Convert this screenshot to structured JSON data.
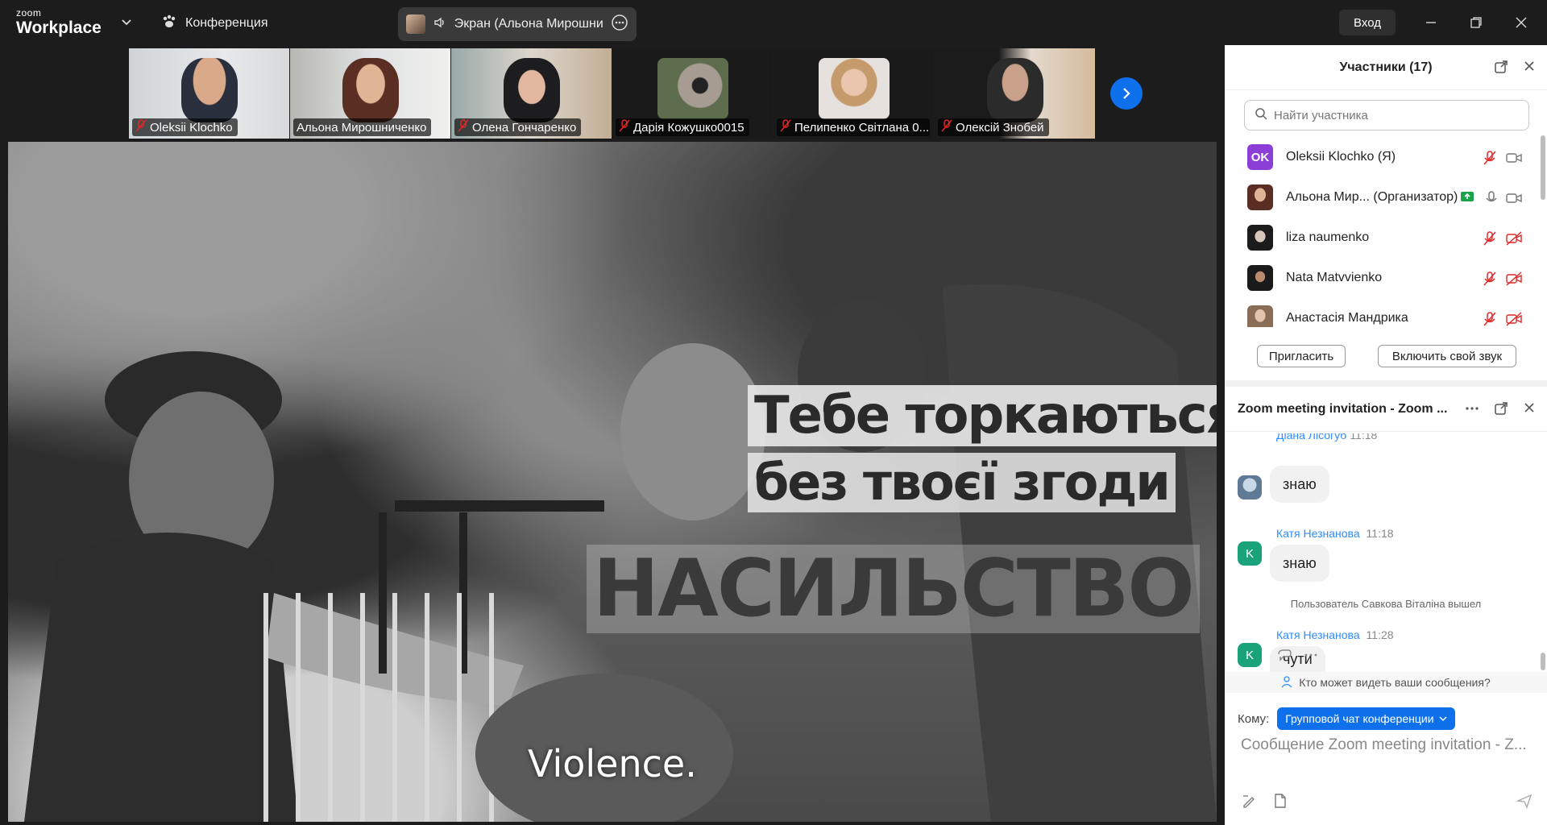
{
  "app": {
    "logo_line1": "zoom",
    "logo_line2": "Workplace",
    "conference_label": "Конференция",
    "share_label": "Экран (Альона Мирошнич",
    "login_label": "Вход"
  },
  "thumbnails": [
    {
      "name": "Oleksii Klochko",
      "muted": true
    },
    {
      "name": "Альона Мирошниченко",
      "muted": false
    },
    {
      "name": "Олена Гончаренко",
      "muted": true
    },
    {
      "name": "Дарія Кожушко0015",
      "muted": true,
      "active": true
    },
    {
      "name": "Пелипенко Світлана 0...",
      "muted": true
    },
    {
      "name": "Олексій Знобей",
      "muted": true
    }
  ],
  "stage": {
    "caption_line1": "Тебе торкаються",
    "caption_line2": "без твоєї згоди",
    "caption_line3": "НАСИЛЬСТВО",
    "subtitle": "Violence."
  },
  "participants": {
    "title": "Участники (17)",
    "search_placeholder": "Найти участника",
    "list": [
      {
        "initials": "OK",
        "name": "Oleksii Klochko (Я)"
      },
      {
        "name": "Альона Мир...  (Организатор)"
      },
      {
        "name": "liza naumenko"
      },
      {
        "name": "Nata Matvvienko"
      },
      {
        "name": "Анастасія Мандрика"
      }
    ],
    "invite_label": "Пригласить",
    "unmute_label": "Включить свой звук"
  },
  "chat": {
    "title": "Zoom meeting invitation - Zoom ...",
    "partial_sender": "Діана Лісогуб",
    "partial_time": "11:18",
    "messages": [
      {
        "text": "знаю"
      },
      {
        "sender": "Катя Незнанова",
        "time": "11:18",
        "initial": "K",
        "text": "знаю"
      },
      {
        "system": "Пользователь Савкова Віталіна вышел"
      },
      {
        "sender": "Катя Незнанова",
        "time": "11:28",
        "initial": "K",
        "text": "чути"
      }
    ],
    "who_can_see": "Кто может видеть ваши сообщения?",
    "to_label": "Кому:",
    "to_value": "Групповой чат конференции",
    "input_placeholder": "Сообщение Zoom meeting invitation - Z..."
  },
  "colors": {
    "accent": "#0e71eb",
    "active_border": "#27c98a",
    "muted_red": "#e02828",
    "avatar_purple": "#8c3fd6",
    "avatar_teal": "#1aa37a"
  }
}
